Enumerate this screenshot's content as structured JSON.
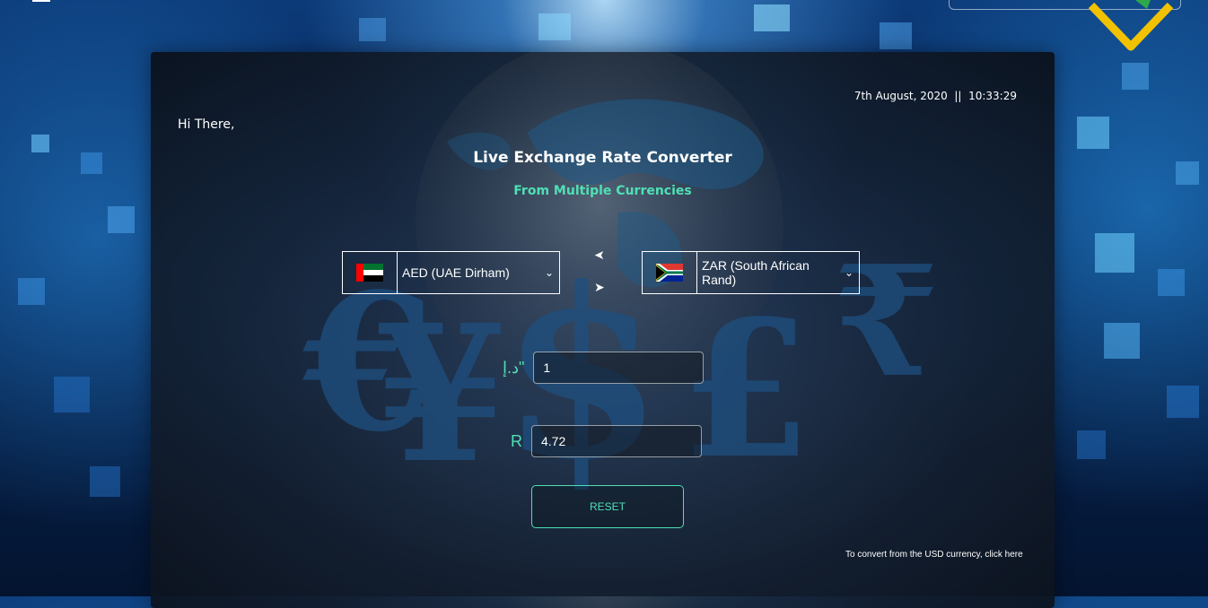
{
  "header": {
    "datetime": "7th August, 2020  ||  10:33:29"
  },
  "main": {
    "greeting": "Hi There,",
    "title": "Live Exchange Rate Converter",
    "subtitle": "From Multiple Currencies"
  },
  "converter": {
    "from_currency": {
      "label": "AED (UAE Dirham)",
      "flag": "uae-flag-icon"
    },
    "to_currency": {
      "label": "ZAR (South African Rand)",
      "flag": "south-africa-flag-icon"
    },
    "from_symbol": "د.إ\"",
    "from_amount": "1",
    "to_symbol": "R",
    "to_amount": "4.72",
    "swap_left_icon": "➤",
    "swap_right_icon": "➤"
  },
  "actions": {
    "reset_label": "RESET",
    "usd_link": "To convert from the USD currency, click here"
  },
  "colors": {
    "accent": "#4fe0b5",
    "background": "#07275a",
    "logo": "#f2c200"
  }
}
